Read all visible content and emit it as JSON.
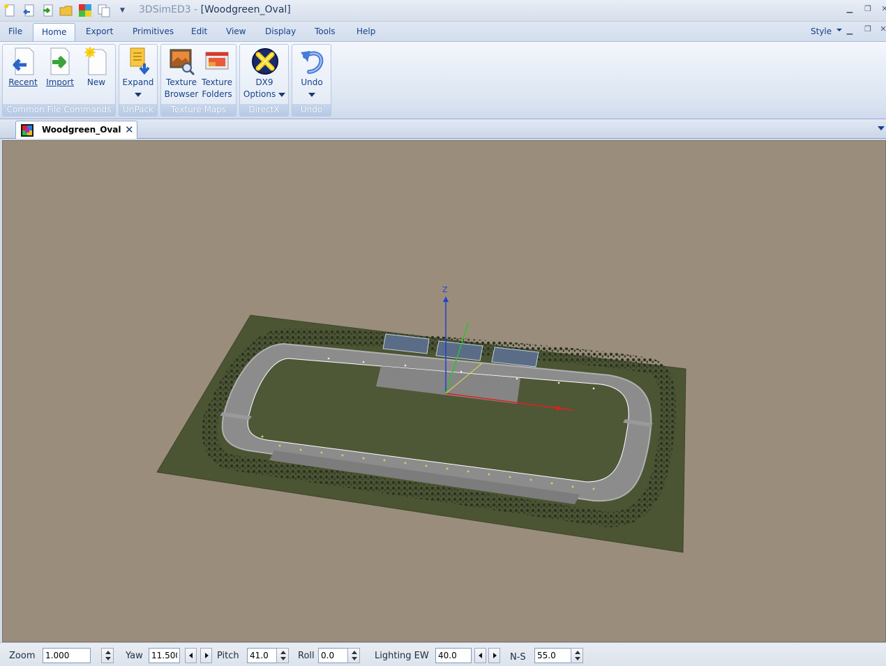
{
  "app": {
    "name": "3DSimED3",
    "separator": " - ",
    "document_title": "[Woodgreen_Oval]"
  },
  "quick_access": {
    "icons": [
      "new-doc-icon",
      "recent-icon",
      "import-icon",
      "open-folder-icon",
      "texture-icon",
      "copy-icon"
    ],
    "dropdown": "▼"
  },
  "menu": {
    "tabs": [
      "File",
      "Home",
      "Export",
      "Primitives",
      "Edit",
      "View",
      "Display",
      "Tools",
      "Help"
    ],
    "active": "Home",
    "style_label": "Style"
  },
  "ribbon": {
    "groups": {
      "common": {
        "caption": "Common File Commands",
        "recent": "Recent",
        "import": "Import",
        "new": "New"
      },
      "unpack": {
        "caption": "UnPack",
        "expand": "Expand"
      },
      "texture_maps": {
        "caption": "Texture Maps",
        "browser_line1": "Texture",
        "browser_line2": "Browser",
        "folders_line1": "Texture",
        "folders_line2": "Folders"
      },
      "directx": {
        "caption": "DirectX",
        "dx9_line1": "DX9",
        "dx9_line2": "Options"
      },
      "undo": {
        "caption": "Undo",
        "undo": "Undo"
      }
    }
  },
  "document_tab": {
    "label": "Woodgreen_Oval",
    "close": "✕"
  },
  "viewport": {
    "axis_label": "Z",
    "colors": {
      "background": "#9a8d7c",
      "ground": "#4b5433",
      "track": "#8c8c8c",
      "infield": "#4f5836",
      "x_axis": "#e02020",
      "y_axis": "#30c030",
      "z_axis": "#2040d0"
    }
  },
  "statusbar": {
    "zoom_label": "Zoom",
    "zoom_value": "1.000",
    "yaw_label": "Yaw",
    "yaw_value": "11.500",
    "pitch_label": "Pitch",
    "pitch_value": "41.0",
    "roll_label": "Roll",
    "roll_value": "0.0",
    "lighting_ew_label": "Lighting EW",
    "lighting_ew_value": "40.0",
    "ns_label": "N-S",
    "ns_value": "55.0"
  }
}
